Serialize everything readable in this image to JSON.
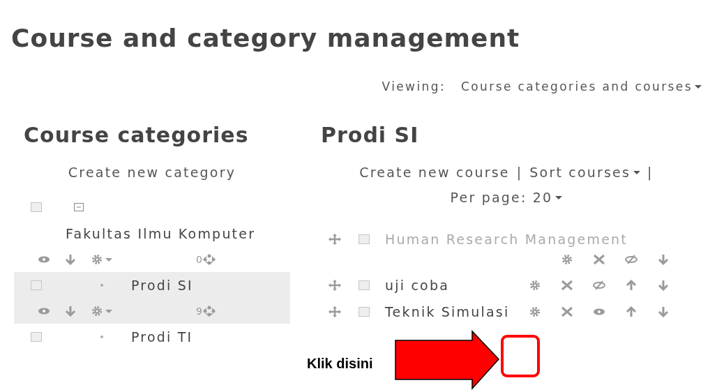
{
  "title": "Course and category management",
  "viewing": {
    "label": "Viewing:",
    "value": "Course categories and courses",
    "dropdown": true
  },
  "categories": {
    "heading": "Course categories",
    "create_link": "Create new category",
    "items": [
      {
        "name": "Fakultas Ilmu Komputer",
        "count": "0",
        "expanded": true,
        "selected": false,
        "checked": false,
        "children": [
          {
            "name": "Prodi SI",
            "count": "9",
            "selected": true,
            "checked": false
          },
          {
            "name": "Prodi TI",
            "selected": false,
            "checked": false
          }
        ]
      }
    ]
  },
  "courses": {
    "heading": "Prodi SI",
    "separator": "|",
    "links": [
      {
        "label": "Create new course",
        "dropdown": false
      },
      {
        "label": "Sort courses",
        "dropdown": true
      }
    ],
    "per_page": {
      "label": "Per page: 20",
      "dropdown": true
    },
    "items": [
      {
        "name": "Human Research Management",
        "dimmed": true,
        "visible": true,
        "checked": false
      },
      {
        "name": "uji coba",
        "dimmed": false,
        "visible": true,
        "checked": false
      },
      {
        "name": "Teknik Simulasi",
        "dimmed": false,
        "visible": false,
        "checked": false
      }
    ]
  },
  "annotation": {
    "text": "Klik disini"
  }
}
